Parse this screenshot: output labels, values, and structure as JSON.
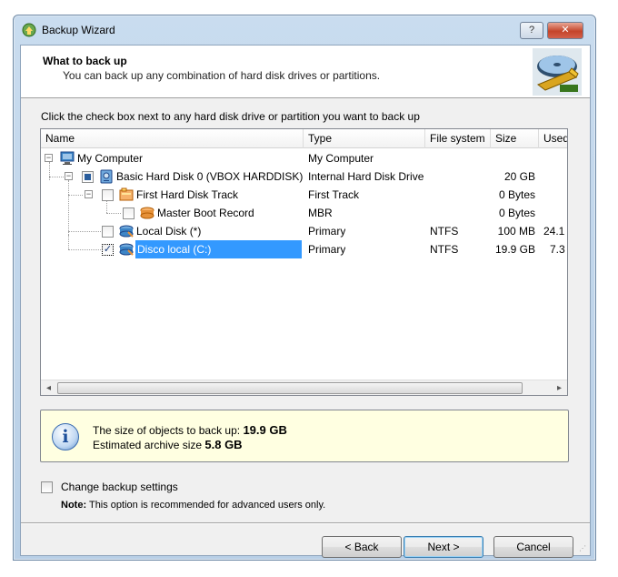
{
  "window": {
    "title": "Backup Wizard",
    "help_label": "?",
    "close_label": "✕"
  },
  "header": {
    "title": "What to back up",
    "subtitle": "You can back up any combination of hard disk drives or partitions."
  },
  "instruction": "Click the check box next to any hard disk drive or partition you want to back up",
  "grid": {
    "columns": [
      "Name",
      "Type",
      "File system",
      "Size",
      "Used"
    ],
    "rows": [
      {
        "name": "My Computer",
        "type": "My Computer",
        "fs": "",
        "size": "",
        "used": "",
        "checked": "none",
        "icon": "computer-icon"
      },
      {
        "name": "Basic Hard Disk 0 (VBOX HARDDISK)",
        "type": "Internal Hard Disk Drive",
        "fs": "",
        "size": "20 GB",
        "used": "",
        "checked": "partial",
        "icon": "hard-disk-icon"
      },
      {
        "name": "First Hard Disk Track",
        "type": "First Track",
        "fs": "",
        "size": "0 Bytes",
        "used": "",
        "checked": "unchecked",
        "icon": "disk-track-icon"
      },
      {
        "name": "Master Boot Record",
        "type": "MBR",
        "fs": "",
        "size": "0 Bytes",
        "used": "",
        "checked": "unchecked",
        "icon": "mbr-icon"
      },
      {
        "name": "Local Disk (*)",
        "type": "Primary",
        "fs": "NTFS",
        "size": "100 MB",
        "used": "24.1",
        "checked": "unchecked",
        "icon": "partition-icon"
      },
      {
        "name": "Disco local (C:)",
        "type": "Primary",
        "fs": "NTFS",
        "size": "19.9 GB",
        "used": "7.3",
        "checked": "checked",
        "icon": "partition-icon",
        "selected": true
      }
    ]
  },
  "info": {
    "line1_label": "The size of objects to back up:",
    "line1_value": "19.9 GB",
    "line2_label": "Estimated archive size",
    "line2_value": "5.8 GB"
  },
  "options": {
    "change_settings_label": "Change backup settings",
    "note_label": "Note:",
    "note_text": "This option is recommended for advanced users only."
  },
  "buttons": {
    "back": "< Back",
    "next": "Next >",
    "cancel": "Cancel"
  }
}
